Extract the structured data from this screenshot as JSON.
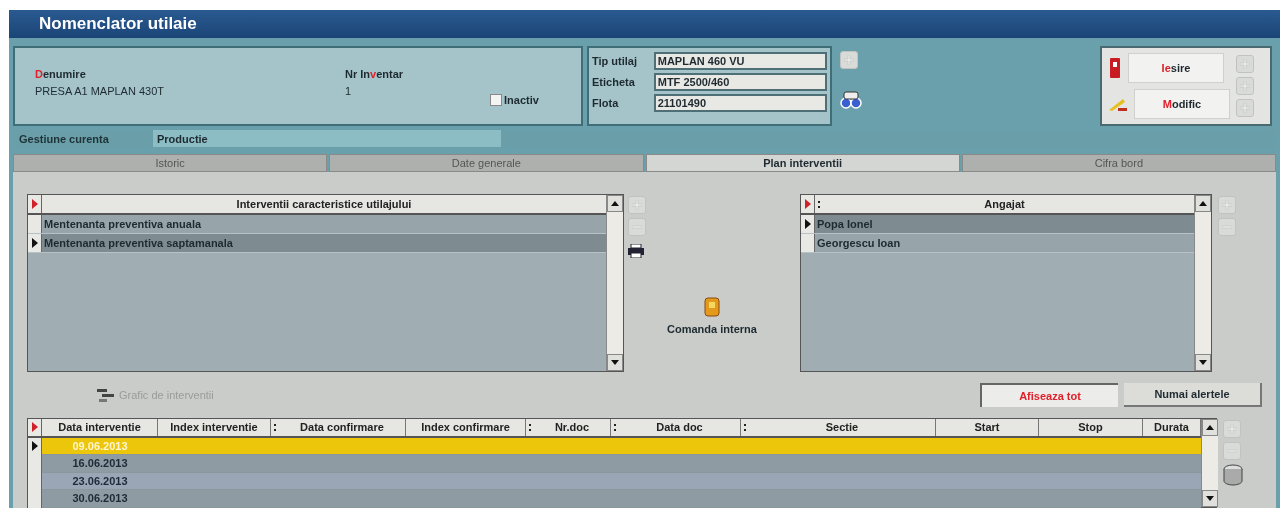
{
  "window": {
    "title": "Nomenclator utilaie"
  },
  "header": {
    "name_label": [
      {
        "text": "D",
        "accent": true
      },
      {
        "text": "enumire",
        "accent": false
      }
    ],
    "name_value": "PRESA A1 MAPLAN 430T",
    "inventory_label": [
      {
        "text": "Nr In",
        "accent": false
      },
      {
        "text": "v",
        "accent": true
      },
      {
        "text": "entar",
        "accent": false
      }
    ],
    "inventory_value": "1",
    "inactive": {
      "label": "Inactiv",
      "checked": false
    },
    "fields": [
      {
        "label": "Tip utilaj",
        "value": "MAPLAN 460 VU"
      },
      {
        "label": "Eticheta",
        "value": "MTF 2500/460"
      },
      {
        "label": "Flota",
        "value": "21101490"
      }
    ]
  },
  "actions": [
    {
      "label": [
        {
          "text": "Ie",
          "accent": true
        },
        {
          "text": "sire",
          "accent": false
        }
      ],
      "kind": "exit"
    },
    {
      "label": [
        {
          "text": "M",
          "accent": true
        },
        {
          "text": "odific",
          "accent": false
        }
      ],
      "kind": "edit"
    }
  ],
  "gestiune": {
    "label": "Gestiune curenta",
    "value": "Productie"
  },
  "tabs": [
    {
      "label": "Istoric",
      "selected": false
    },
    {
      "label": "Date generale",
      "selected": false
    },
    {
      "label": "Plan interventii",
      "selected": true
    },
    {
      "label": "Cifra bord",
      "selected": false
    }
  ],
  "interventions": {
    "header": "Interventii caracteristice utilajului",
    "rows": [
      {
        "text": "Mentenanta preventiva anuala",
        "selected": false
      },
      {
        "text": "Mentenanta preventiva saptamanala",
        "selected": true
      }
    ]
  },
  "internal_order": {
    "label": "Comanda interna"
  },
  "employees": {
    "header": "Angajat",
    "rows": [
      {
        "text": "Popa Ionel",
        "selected": true
      },
      {
        "text": "Georgescu Ioan",
        "selected": false
      }
    ]
  },
  "chart_button": {
    "label": "Grafic de interventii",
    "disabled": true
  },
  "filters": [
    {
      "label": "Afiseaza tot",
      "selected": true
    },
    {
      "label": "Numai alertele",
      "selected": false
    }
  ],
  "table": {
    "columns": [
      {
        "label": "Data interventie",
        "sort": false
      },
      {
        "label": "Index interventie",
        "sort": false
      },
      {
        "label": "Data confirmare",
        "sort": true
      },
      {
        "label": "Index confirmare",
        "sort": false
      },
      {
        "label": "Nr.doc",
        "sort": true
      },
      {
        "label": "Data doc",
        "sort": true
      },
      {
        "label": "Sectie",
        "sort": true
      },
      {
        "label": "Start",
        "sort": false
      },
      {
        "label": "Stop",
        "sort": false
      },
      {
        "label": "Durata",
        "sort": false
      }
    ],
    "rows": [
      {
        "date": "09.06.2013",
        "selected": true
      },
      {
        "date": "16.06.2013",
        "selected": false
      },
      {
        "date": "23.06.2013",
        "selected": false
      },
      {
        "date": "30.06.2013",
        "selected": false
      }
    ]
  }
}
